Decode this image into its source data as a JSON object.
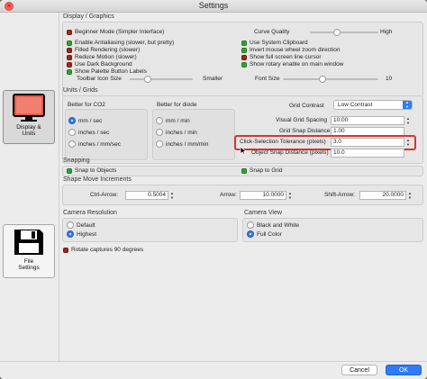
{
  "window": {
    "title": "Settings"
  },
  "sidebar": [
    {
      "label": "Display &\nUnits",
      "icon": "monitor-icon",
      "active": true
    },
    {
      "label": "File\nSettings",
      "icon": "floppy-disk-icon",
      "active": false
    }
  ],
  "display": {
    "heading": "Display / Graphics",
    "left_checks": [
      {
        "label": "Beginner Mode (Simpler Interface)",
        "checked": false
      },
      {
        "label": "Enable Antialiasing (slower, but pretty)",
        "checked": true
      },
      {
        "label": "Filled Rendering (slower)",
        "checked": false
      },
      {
        "label": "Reduce Motion (slower)",
        "checked": false
      },
      {
        "label": "Use Dark Background",
        "checked": false
      },
      {
        "label": "Show Palette Button Labels",
        "checked": true
      }
    ],
    "right_checks": [
      {
        "label": "Use System Clipboard",
        "checked": true
      },
      {
        "label": "Invert mouse wheel zoom direction",
        "checked": true
      },
      {
        "label": "Show full screen line cursor",
        "checked": false
      },
      {
        "label": "Show rotary enable on main window",
        "checked": true
      }
    ],
    "curve_quality": {
      "label": "Curve Quality",
      "max_label": "High",
      "value": 0.35
    },
    "toolbar_icon": {
      "label": "Toolbar Icon Size",
      "min_label": "Smaller",
      "value": 0.25
    },
    "font_size": {
      "label": "Font Size",
      "value_label": "10",
      "value": 0.4
    }
  },
  "units": {
    "heading": "Units / Grids",
    "co2": {
      "title": "Better for CO2",
      "options": [
        "mm / sec",
        "inches / sec",
        "inches / mm/sec"
      ],
      "selected": 0
    },
    "diode": {
      "title": "Better for diode",
      "options": [
        "mm / min",
        "inches / min",
        "inches / mm/min"
      ],
      "selected": -1
    },
    "grid_contrast": {
      "label": "Grid Contrast",
      "value": "Low Contrast"
    },
    "visual_grid_spacing": {
      "label": "Visual Grid Spacing",
      "value": "10.00"
    },
    "grid_snap_distance": {
      "label": "Grid Snap Distance",
      "value": "1.00"
    },
    "click_tolerance": {
      "label": "Click-Selection Tolerance (pixels)",
      "value": "3.0"
    },
    "object_snap": {
      "label": "Object Snap Distance (pixels)",
      "value": "10.0"
    }
  },
  "snapping": {
    "heading": "Snapping",
    "snap_objects": {
      "label": "Snap to Objects",
      "checked": true
    },
    "snap_grid": {
      "label": "Snap to Grid",
      "checked": true
    }
  },
  "shape_move": {
    "heading": "Shape Move Increments",
    "ctrl_arrow": {
      "label": "Ctrl-Arrow:",
      "value": "0.5004"
    },
    "arrow": {
      "label": "Arrow:",
      "value": "10.0000"
    },
    "shift_arrow": {
      "label": "Shift-Arrow:",
      "value": "20.0000"
    }
  },
  "camera_resolution": {
    "heading": "Camera Resolution",
    "options": [
      "Default",
      "Highest"
    ],
    "selected": 1
  },
  "camera_view": {
    "heading": "Camera View",
    "options": [
      "Black and White",
      "Full Color"
    ],
    "selected": 1
  },
  "rotate_captures": {
    "label": "Rotate captures 90 degrees",
    "checked": false
  },
  "footer": {
    "cancel_label": "Cancel",
    "ok_label": "OK"
  },
  "colors": {
    "accent": "#2f7bf5",
    "check_on": "#2fa52f",
    "check_off": "#9e2a1a",
    "highlight": "#d9342b"
  }
}
